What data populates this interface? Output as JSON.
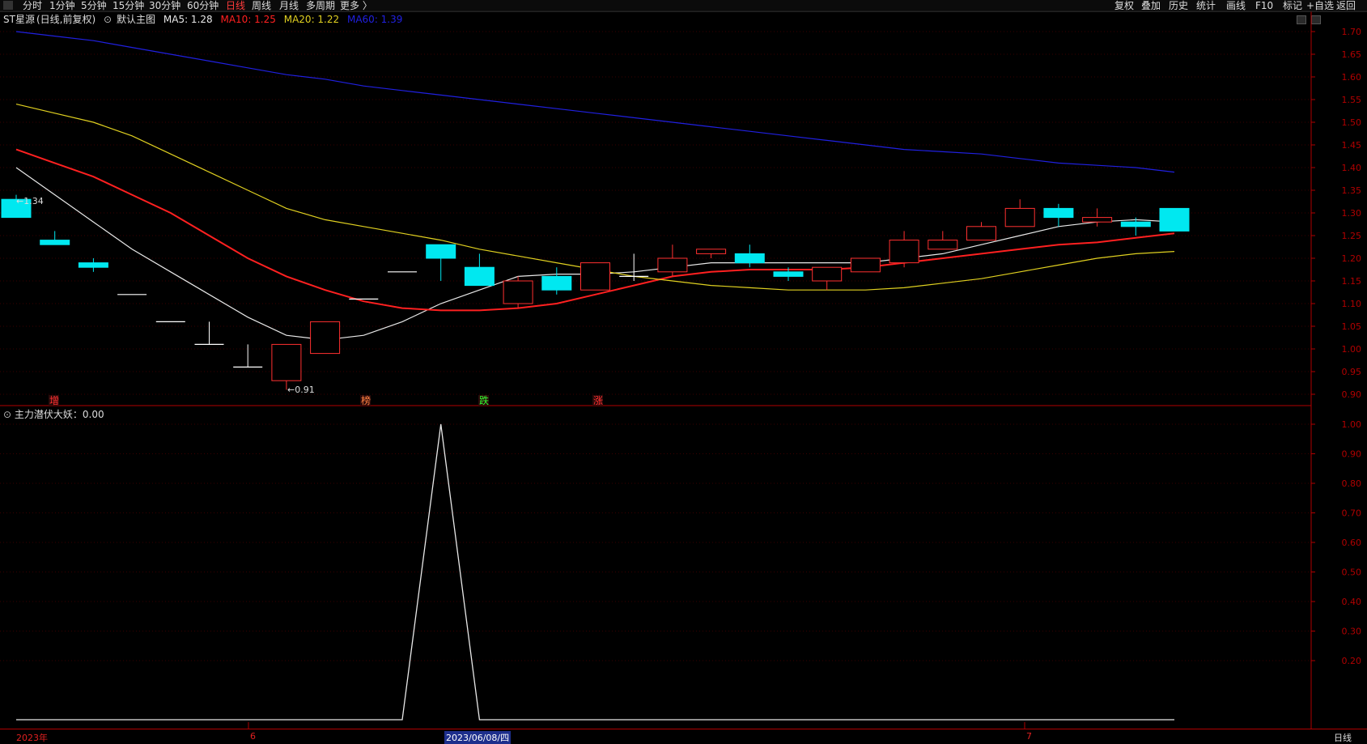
{
  "menu": {
    "left_items": [
      "分时",
      "1分钟",
      "5分钟",
      "15分钟",
      "30分钟",
      "60分钟",
      "日线",
      "周线",
      "月线",
      "多周期",
      "更多 〉"
    ],
    "active": "日线",
    "right_items": [
      "复权",
      "叠加",
      "历史",
      "统计",
      "画线",
      "F10",
      "标记",
      "+自选",
      "返回"
    ]
  },
  "header": {
    "stock": "ST星源",
    "mode": "(日线,前复权)",
    "main": "默认主图",
    "ma5": "MA5: 1.28",
    "ma10": "MA10: 1.25",
    "ma20": "MA20: 1.22",
    "ma60": "MA60: 1.39"
  },
  "colors": {
    "ma5": "#e8e8e8",
    "ma10": "#ff2020",
    "ma20": "#e0d020",
    "ma60": "#2020e0",
    "up": "#ff3030",
    "down": "#00e8f0",
    "axis": "#b00000"
  },
  "price_axis": [
    "1.70",
    "1.65",
    "1.60",
    "1.55",
    "1.50",
    "1.45",
    "1.40",
    "1.35",
    "1.30",
    "1.25",
    "1.20",
    "1.15",
    "1.10",
    "1.05",
    "1.00",
    "0.95",
    "0.90"
  ],
  "annotations": {
    "high": "1.34",
    "low": "0.91",
    "markers": [
      {
        "text": "增",
        "color": "#ff3030"
      },
      {
        "text": "榜",
        "color": "#ff8040"
      },
      {
        "text": "跌",
        "color": "#30ff30"
      },
      {
        "text": "涨",
        "color": "#ff3030"
      }
    ]
  },
  "indicator": {
    "title": "主力潜伏大妖：0.00",
    "axis": [
      "1.00",
      "0.90",
      "0.80",
      "0.70",
      "0.60",
      "0.50",
      "0.40",
      "0.30",
      "0.20"
    ],
    "values": [
      0,
      0,
      0,
      0,
      0,
      0,
      0,
      0,
      0,
      0,
      0,
      1,
      0,
      0,
      0,
      0,
      0,
      0,
      0,
      0,
      0,
      0,
      0,
      0,
      0,
      0,
      0,
      0,
      0,
      0,
      0
    ]
  },
  "dates": {
    "d1": "2023年",
    "d2": "6",
    "d3": "2023/06/08/四",
    "d4": "7"
  },
  "period_tab": "日线",
  "chart_data": {
    "type": "candlestick",
    "x": [
      "1",
      "2",
      "3",
      "4",
      "5",
      "6",
      "7",
      "8",
      "9",
      "10",
      "11",
      "12",
      "13",
      "14",
      "15",
      "16",
      "17",
      "18",
      "19",
      "20",
      "21",
      "22",
      "23",
      "24",
      "25",
      "26",
      "27",
      "28",
      "29",
      "30",
      "31"
    ],
    "candles": [
      {
        "o": 1.33,
        "h": 1.34,
        "l": 1.29,
        "c": 1.29
      },
      {
        "o": 1.24,
        "h": 1.26,
        "l": 1.23,
        "c": 1.23
      },
      {
        "o": 1.19,
        "h": 1.2,
        "l": 1.17,
        "c": 1.18
      },
      {
        "o": 1.12,
        "h": 1.12,
        "l": 1.12,
        "c": 1.12
      },
      {
        "o": 1.06,
        "h": 1.06,
        "l": 1.06,
        "c": 1.06
      },
      {
        "o": 1.01,
        "h": 1.06,
        "l": 1.01,
        "c": 1.01
      },
      {
        "o": 0.96,
        "h": 1.01,
        "l": 0.96,
        "c": 0.96
      },
      {
        "o": 0.93,
        "h": 1.01,
        "l": 0.91,
        "c": 1.01
      },
      {
        "o": 0.99,
        "h": 1.06,
        "l": 0.99,
        "c": 1.06
      },
      {
        "o": 1.11,
        "h": 1.11,
        "l": 1.11,
        "c": 1.11
      },
      {
        "o": 1.17,
        "h": 1.17,
        "l": 1.17,
        "c": 1.17
      },
      {
        "o": 1.23,
        "h": 1.23,
        "l": 1.15,
        "c": 1.2
      },
      {
        "o": 1.18,
        "h": 1.21,
        "l": 1.14,
        "c": 1.14
      },
      {
        "o": 1.1,
        "h": 1.16,
        "l": 1.09,
        "c": 1.15
      },
      {
        "o": 1.16,
        "h": 1.18,
        "l": 1.12,
        "c": 1.13
      },
      {
        "o": 1.13,
        "h": 1.19,
        "l": 1.13,
        "c": 1.19
      },
      {
        "o": 1.16,
        "h": 1.21,
        "l": 1.15,
        "c": 1.16
      },
      {
        "o": 1.17,
        "h": 1.23,
        "l": 1.16,
        "c": 1.2
      },
      {
        "o": 1.21,
        "h": 1.22,
        "l": 1.2,
        "c": 1.22
      },
      {
        "o": 1.21,
        "h": 1.23,
        "l": 1.18,
        "c": 1.19
      },
      {
        "o": 1.17,
        "h": 1.18,
        "l": 1.15,
        "c": 1.16
      },
      {
        "o": 1.15,
        "h": 1.18,
        "l": 1.13,
        "c": 1.18
      },
      {
        "o": 1.17,
        "h": 1.2,
        "l": 1.17,
        "c": 1.2
      },
      {
        "o": 1.19,
        "h": 1.26,
        "l": 1.18,
        "c": 1.24
      },
      {
        "o": 1.22,
        "h": 1.26,
        "l": 1.22,
        "c": 1.24
      },
      {
        "o": 1.24,
        "h": 1.28,
        "l": 1.24,
        "c": 1.27
      },
      {
        "o": 1.27,
        "h": 1.33,
        "l": 1.27,
        "c": 1.31
      },
      {
        "o": 1.31,
        "h": 1.32,
        "l": 1.27,
        "c": 1.29
      },
      {
        "o": 1.28,
        "h": 1.31,
        "l": 1.27,
        "c": 1.29
      },
      {
        "o": 1.28,
        "h": 1.29,
        "l": 1.25,
        "c": 1.27
      },
      {
        "o": 1.31,
        "h": 1.31,
        "l": 1.26,
        "c": 1.26
      }
    ],
    "series": [
      {
        "name": "MA5",
        "values": [
          1.4,
          1.34,
          1.28,
          1.22,
          1.17,
          1.12,
          1.07,
          1.03,
          1.02,
          1.03,
          1.06,
          1.1,
          1.13,
          1.16,
          1.165,
          1.165,
          1.17,
          1.18,
          1.19,
          1.19,
          1.19,
          1.19,
          1.19,
          1.2,
          1.21,
          1.23,
          1.25,
          1.27,
          1.28,
          1.285,
          1.28
        ]
      },
      {
        "name": "MA10",
        "values": [
          1.44,
          1.41,
          1.38,
          1.34,
          1.3,
          1.25,
          1.2,
          1.16,
          1.13,
          1.105,
          1.09,
          1.085,
          1.085,
          1.09,
          1.1,
          1.12,
          1.14,
          1.16,
          1.17,
          1.175,
          1.175,
          1.175,
          1.18,
          1.19,
          1.2,
          1.21,
          1.22,
          1.23,
          1.235,
          1.245,
          1.255
        ]
      },
      {
        "name": "MA20",
        "values": [
          1.54,
          1.52,
          1.5,
          1.47,
          1.43,
          1.39,
          1.35,
          1.31,
          1.285,
          1.27,
          1.255,
          1.24,
          1.22,
          1.205,
          1.19,
          1.175,
          1.16,
          1.15,
          1.14,
          1.135,
          1.13,
          1.13,
          1.13,
          1.135,
          1.145,
          1.155,
          1.17,
          1.185,
          1.2,
          1.21,
          1.215
        ]
      },
      {
        "name": "MA60",
        "values": [
          1.7,
          1.69,
          1.68,
          1.665,
          1.65,
          1.635,
          1.62,
          1.605,
          1.595,
          1.58,
          1.57,
          1.56,
          1.55,
          1.54,
          1.53,
          1.52,
          1.51,
          1.5,
          1.49,
          1.48,
          1.47,
          1.46,
          1.45,
          1.44,
          1.435,
          1.43,
          1.42,
          1.41,
          1.405,
          1.4,
          1.39
        ]
      }
    ],
    "ylim": [
      0.87,
      1.73
    ]
  }
}
